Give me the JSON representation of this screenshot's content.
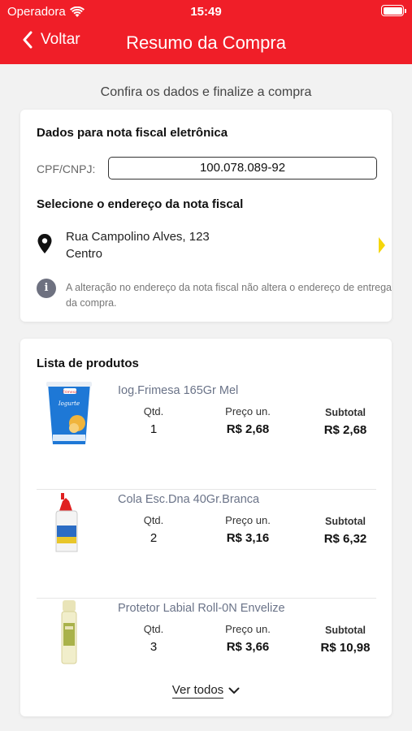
{
  "status_bar": {
    "carrier": "Operadora",
    "time": "15:49"
  },
  "header": {
    "back_label": "Voltar",
    "title": "Resumo da Compra"
  },
  "subtitle": "Confira os dados e finalize a compra",
  "invoice": {
    "heading": "Dados para nota fiscal eletrônica",
    "cpf_label": "CPF/CNPJ:",
    "cpf_value": "100.078.089-92",
    "address_heading": "Selecione o endereço da nota fiscal",
    "address_line1": "Rua Campolino Alves, 123",
    "address_line2": "Centro",
    "info_text": "A alteração no endereço da nota fiscal não altera o endereço de entrega da compra."
  },
  "products": {
    "heading": "Lista de produtos",
    "qty_label": "Qtd.",
    "price_label": "Preço un.",
    "subtotal_label": "Subtotal",
    "items": [
      {
        "name": "Iog.Frimesa 165Gr Mel",
        "qty": "1",
        "price": "R$ 2,68",
        "subtotal": "R$ 2,68"
      },
      {
        "name": "Cola Esc.Dna 40Gr.Branca",
        "qty": "2",
        "price": "R$ 3,16",
        "subtotal": "R$ 6,32"
      },
      {
        "name": "Protetor Labial Roll-0N Envelize",
        "qty": "3",
        "price": "R$ 3,66",
        "subtotal": "R$ 10,98"
      }
    ],
    "see_all": "Ver todos"
  },
  "colors": {
    "header": "#f01e28",
    "accent_chevron": "#f5d60a",
    "product_name": "#6a7388"
  }
}
